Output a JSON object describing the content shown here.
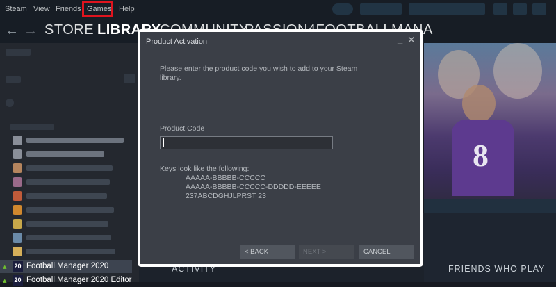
{
  "menubar": {
    "items": [
      "Steam",
      "View",
      "Friends",
      "Games",
      "Help"
    ]
  },
  "nav": {
    "back": "←",
    "forward": "→",
    "store": "STORE",
    "library": "LIBRARY",
    "community": "COMMUNITY",
    "username": "PASSION4FOOTBALLMANA"
  },
  "sidebar": {
    "games": [
      {
        "label": "Football Manager 2020",
        "icon": "20"
      },
      {
        "label": "Football Manager 2020 Editor",
        "icon": "20"
      }
    ]
  },
  "art": {
    "number": "8"
  },
  "sections": {
    "activity": "ACTIVITY",
    "friends": "FRIENDS WHO PLAY"
  },
  "dialog": {
    "title": "Product Activation",
    "minimize": "_",
    "close": "✕",
    "intro_line1": "Please enter the product code you wish to add to your Steam",
    "intro_line2": "library.",
    "code_label": "Product Code",
    "code_value": "",
    "keys_heading": "Keys look like the following:",
    "key_examples": [
      "AAAAA-BBBBB-CCCCC",
      "AAAAA-BBBBB-CCCCC-DDDDD-EEEEE",
      "237ABCDGHJLPRST 23"
    ],
    "buttons": {
      "back": "< BACK",
      "next": "NEXT >",
      "cancel": "CANCEL"
    }
  },
  "colors": {
    "highlight": "#e0141e",
    "dialog_bg": "#3b3f47",
    "steam_dark": "#171a21"
  }
}
